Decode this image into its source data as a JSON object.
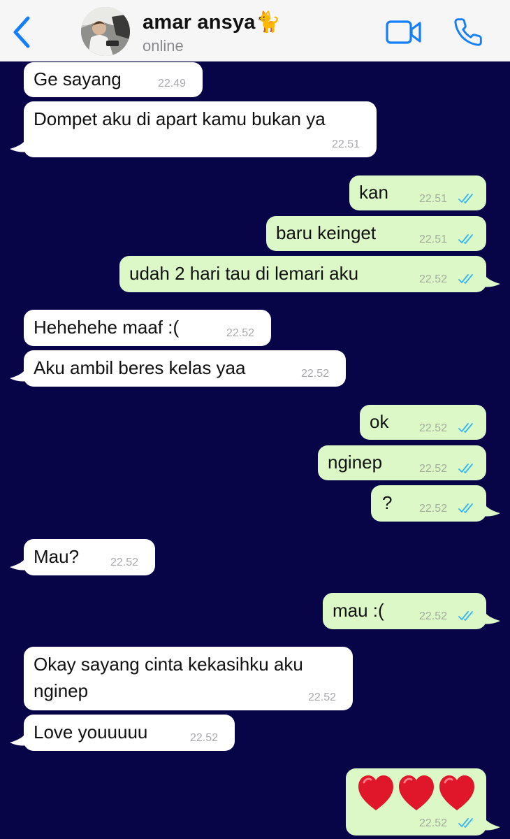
{
  "header": {
    "back_label": "Back",
    "contact_name": "amar ansya🐈",
    "status": "online"
  },
  "colors": {
    "chat_background": "#070447",
    "incoming_bubble": "#ffffff",
    "outgoing_bubble": "#dcf8c6",
    "accent": "#147efb",
    "read_ticks": "#34b7f1"
  },
  "icons": {
    "back": "chevron-left-icon",
    "video": "video-camera-icon",
    "call": "phone-icon",
    "read_receipt": "double-check-icon"
  },
  "messages": [
    {
      "dir": "in",
      "text": "Ge sayang",
      "time": "22.49"
    },
    {
      "dir": "in",
      "text": "Dompet aku di apart kamu bukan ya",
      "time": "22.51"
    },
    {
      "dir": "out",
      "text": "kan",
      "time": "22.51"
    },
    {
      "dir": "out",
      "text": "baru keinget",
      "time": "22.51"
    },
    {
      "dir": "out",
      "text": "udah 2 hari tau di lemari aku",
      "time": "22.52"
    },
    {
      "dir": "in",
      "text": "Hehehehe maaf :(",
      "time": "22.52"
    },
    {
      "dir": "in",
      "text": "Aku ambil beres kelas yaa",
      "time": "22.52"
    },
    {
      "dir": "out",
      "text": "ok",
      "time": "22.52"
    },
    {
      "dir": "out",
      "text": "nginep",
      "time": "22.52"
    },
    {
      "dir": "out",
      "text": "?",
      "time": "22.52"
    },
    {
      "dir": "in",
      "text": "Mau?",
      "time": "22.52"
    },
    {
      "dir": "out",
      "text": "mau :(",
      "time": "22.52"
    },
    {
      "dir": "in",
      "text": "Okay sayang cinta kekasihku aku",
      "text2": "nginep",
      "time": "22.52"
    },
    {
      "dir": "in",
      "text": "Love youuuuu",
      "time": "22.52"
    },
    {
      "dir": "out",
      "text": "❤️❤️❤️",
      "time": "22.52",
      "emoji": "three-red-hearts"
    }
  ]
}
